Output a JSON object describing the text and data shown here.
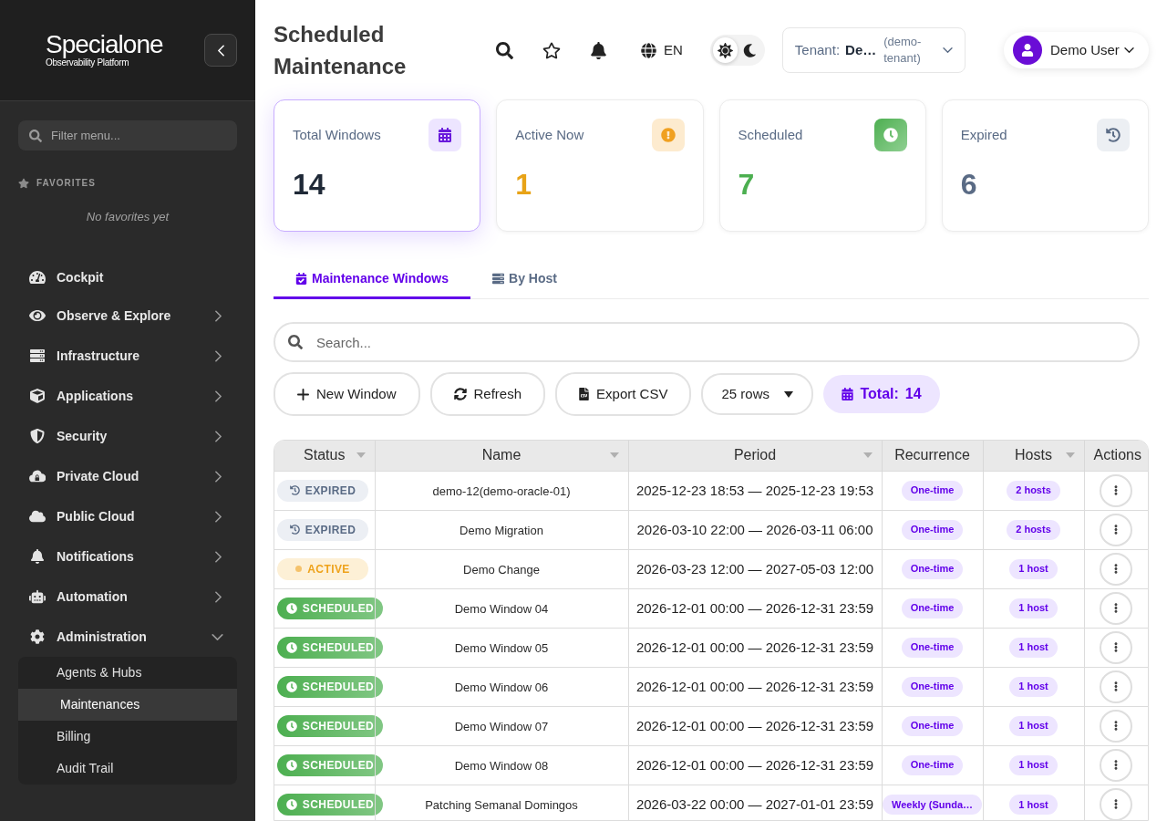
{
  "sidebar": {
    "logo": {
      "name": "Specialone",
      "tagline": "Observability Platform"
    },
    "filter": {
      "placeholder": "Filter menu..."
    },
    "favorites": {
      "heading": "FAVORITES",
      "empty_text": "No favorites yet"
    },
    "items": [
      {
        "label": "Cockpit",
        "kind": "link"
      },
      {
        "label": "Observe & Explore",
        "kind": "group",
        "expanded": false
      },
      {
        "label": "Infrastructure",
        "kind": "group",
        "expanded": false
      },
      {
        "label": "Applications",
        "kind": "group",
        "expanded": false
      },
      {
        "label": "Security",
        "kind": "group",
        "expanded": false
      },
      {
        "label": "Private Cloud",
        "kind": "group",
        "expanded": false
      },
      {
        "label": "Public Cloud",
        "kind": "group",
        "expanded": false
      },
      {
        "label": "Notifications",
        "kind": "group",
        "expanded": false
      },
      {
        "label": "Automation",
        "kind": "group",
        "expanded": false
      },
      {
        "label": "Administration",
        "kind": "group",
        "expanded": true,
        "children": [
          {
            "label": "Agents & Hubs",
            "selected": false
          },
          {
            "label": "Maintenances",
            "selected": true
          },
          {
            "label": "Billing",
            "selected": false
          },
          {
            "label": "Audit Trail",
            "selected": false
          }
        ]
      }
    ]
  },
  "header": {
    "title": "Scheduled Maintenance",
    "language": "EN",
    "dark_mode": false,
    "tenant": {
      "label": "Tenant:",
      "name": "De…",
      "id": "(demo-tenant)"
    },
    "user": {
      "name": "Demo User"
    }
  },
  "stats": [
    {
      "label": "Total Windows",
      "value": "14",
      "selected": true,
      "color": "#1f2937"
    },
    {
      "label": "Active Now",
      "value": "1",
      "selected": false,
      "color": "#e8a317"
    },
    {
      "label": "Scheduled",
      "value": "7",
      "selected": false,
      "color": "#4caf50"
    },
    {
      "label": "Expired",
      "value": "6",
      "selected": false,
      "color": "#5a6b85"
    }
  ],
  "tabs": [
    {
      "label": "Maintenance Windows",
      "selected": true
    },
    {
      "label": "By Host",
      "selected": false
    }
  ],
  "search": {
    "placeholder": "Search..."
  },
  "toolbar": {
    "buttons": [
      {
        "label": "New Window",
        "kind": "add"
      },
      {
        "label": "Refresh",
        "kind": "refresh"
      },
      {
        "label": "Export CSV",
        "kind": "export"
      }
    ],
    "rows_select": {
      "value": "25 rows"
    },
    "total": {
      "label": "Total:",
      "value": "14"
    }
  },
  "table": {
    "columns": [
      {
        "label": "Status",
        "sortable": true
      },
      {
        "label": "Name",
        "sortable": true
      },
      {
        "label": "Period",
        "sortable": true
      },
      {
        "label": "Recurrence",
        "sortable": false
      },
      {
        "label": "Hosts",
        "sortable": true
      },
      {
        "label": "Actions",
        "sortable": false
      }
    ],
    "rows": [
      {
        "status": {
          "kind": "expired",
          "label": "EXPIRED"
        },
        "name": "demo-12(demo-oracle-01)",
        "period": "2025-12-23 18:53 — 2025-12-23 19:53",
        "recurrence": "One-time",
        "hosts": "2 hosts"
      },
      {
        "status": {
          "kind": "expired",
          "label": "EXPIRED"
        },
        "name": "Demo Migration",
        "period": "2026-03-10 22:00 — 2026-03-11 06:00",
        "recurrence": "One-time",
        "hosts": "2 hosts"
      },
      {
        "status": {
          "kind": "active",
          "label": "ACTIVE"
        },
        "name": "Demo Change",
        "period": "2026-03-23 12:00 — 2027-05-03 12:00",
        "recurrence": "One-time",
        "hosts": "1 host"
      },
      {
        "status": {
          "kind": "scheduled",
          "label": "SCHEDULED"
        },
        "name": "Demo Window 04",
        "period": "2026-12-01 00:00 — 2026-12-31 23:59",
        "recurrence": "One-time",
        "hosts": "1 host"
      },
      {
        "status": {
          "kind": "scheduled",
          "label": "SCHEDULED"
        },
        "name": "Demo Window 05",
        "period": "2026-12-01 00:00 — 2026-12-31 23:59",
        "recurrence": "One-time",
        "hosts": "1 host"
      },
      {
        "status": {
          "kind": "scheduled",
          "label": "SCHEDULED"
        },
        "name": "Demo Window 06",
        "period": "2026-12-01 00:00 — 2026-12-31 23:59",
        "recurrence": "One-time",
        "hosts": "1 host"
      },
      {
        "status": {
          "kind": "scheduled",
          "label": "SCHEDULED"
        },
        "name": "Demo Window 07",
        "period": "2026-12-01 00:00 — 2026-12-31 23:59",
        "recurrence": "One-time",
        "hosts": "1 host"
      },
      {
        "status": {
          "kind": "scheduled",
          "label": "SCHEDULED"
        },
        "name": "Demo Window 08",
        "period": "2026-12-01 00:00 — 2026-12-31 23:59",
        "recurrence": "One-time",
        "hosts": "1 host"
      },
      {
        "status": {
          "kind": "scheduled",
          "label": "SCHEDULED"
        },
        "name": "Patching Semanal Domingos",
        "period": "2026-03-22 00:00 — 2027-01-01 23:59",
        "recurrence": "Weekly (Sunda…",
        "hosts": "1 host"
      }
    ]
  }
}
